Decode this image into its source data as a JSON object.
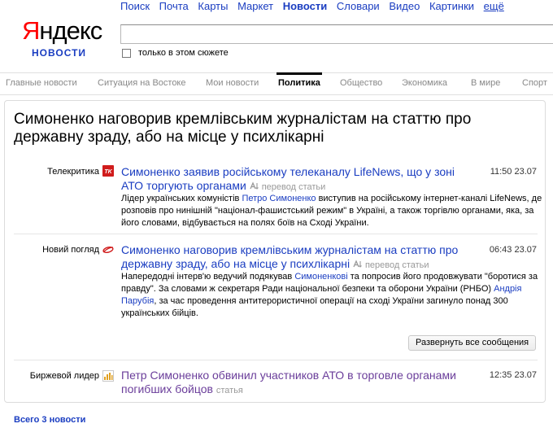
{
  "logo": {
    "first_letter": "Я",
    "rest": "ндекс",
    "sub": "НОВОСТИ"
  },
  "services": [
    {
      "label": "Поиск"
    },
    {
      "label": "Почта"
    },
    {
      "label": "Карты"
    },
    {
      "label": "Маркет"
    },
    {
      "label": "Новости",
      "active": true
    },
    {
      "label": "Словари"
    },
    {
      "label": "Видео"
    },
    {
      "label": "Картинки"
    },
    {
      "label": "ещё"
    }
  ],
  "search": {
    "value": "",
    "placeholder": ""
  },
  "only_story_label": "только в этом сюжете",
  "nav": [
    {
      "label": "Главные новости"
    },
    {
      "label": "Ситуация на Востоке"
    },
    {
      "label": "Мои новости"
    },
    {
      "label": "Политика",
      "active": true
    },
    {
      "label": "Общество"
    },
    {
      "label": "Экономика"
    },
    {
      "label": "В мире"
    },
    {
      "label": "Спорт"
    }
  ],
  "story": {
    "title": "Симоненко наговорив кремлівським журналістам на статтю про державну зраду, або на місце у психлікарні",
    "items": [
      {
        "source": "Телекритика",
        "icon_text": "TK",
        "headline": "Симоненко заявив російському телеканалу LifeNews, що у зоні АТО торгують органами",
        "meta": "перевод статьи",
        "time": "11:50 23.07",
        "snippet_parts": [
          "Лідер українських комуністів ",
          "Петро Симоненко",
          " виступив на російському інтернет-каналі LifeNews, де розповів про нинішній \"націонал-фашистський режим\" в Україні, а також торгівлю органами, яка, за його словами, відбувається на полях боїв на Сході України."
        ]
      },
      {
        "source": "Новий погляд",
        "headline": "Симоненко наговорив кремлівським журналістам на статтю про державну зраду, або на місце у психлікарні",
        "meta": "перевод статьи",
        "time": "06:43 23.07",
        "snippet_parts": [
          "Напередодні інтерв'ю ведучий подякував ",
          "Симоненкові",
          " та попросив його продовжувати \"боротися за правду\". За словами ж секретаря Ради національної безпеки та оборони України (РНБО) ",
          "Андрія Парубія",
          ", за час проведення антитерористичної операції на сході України загинуло понад 300 українських бійців."
        ]
      },
      {
        "source": "Биржевой лидер",
        "headline": "Петр Симоненко обвинил участников АТО в торговле органами погибших бойцов",
        "meta": "статья",
        "time": "12:35 23.07"
      }
    ],
    "expand_label": "Развернуть все сообщения"
  },
  "total_label": "Всего 3 новости",
  "colors": {
    "link": "#1a3dc1",
    "visited": "#6a3d9a",
    "logo_red": "#ff0000"
  }
}
